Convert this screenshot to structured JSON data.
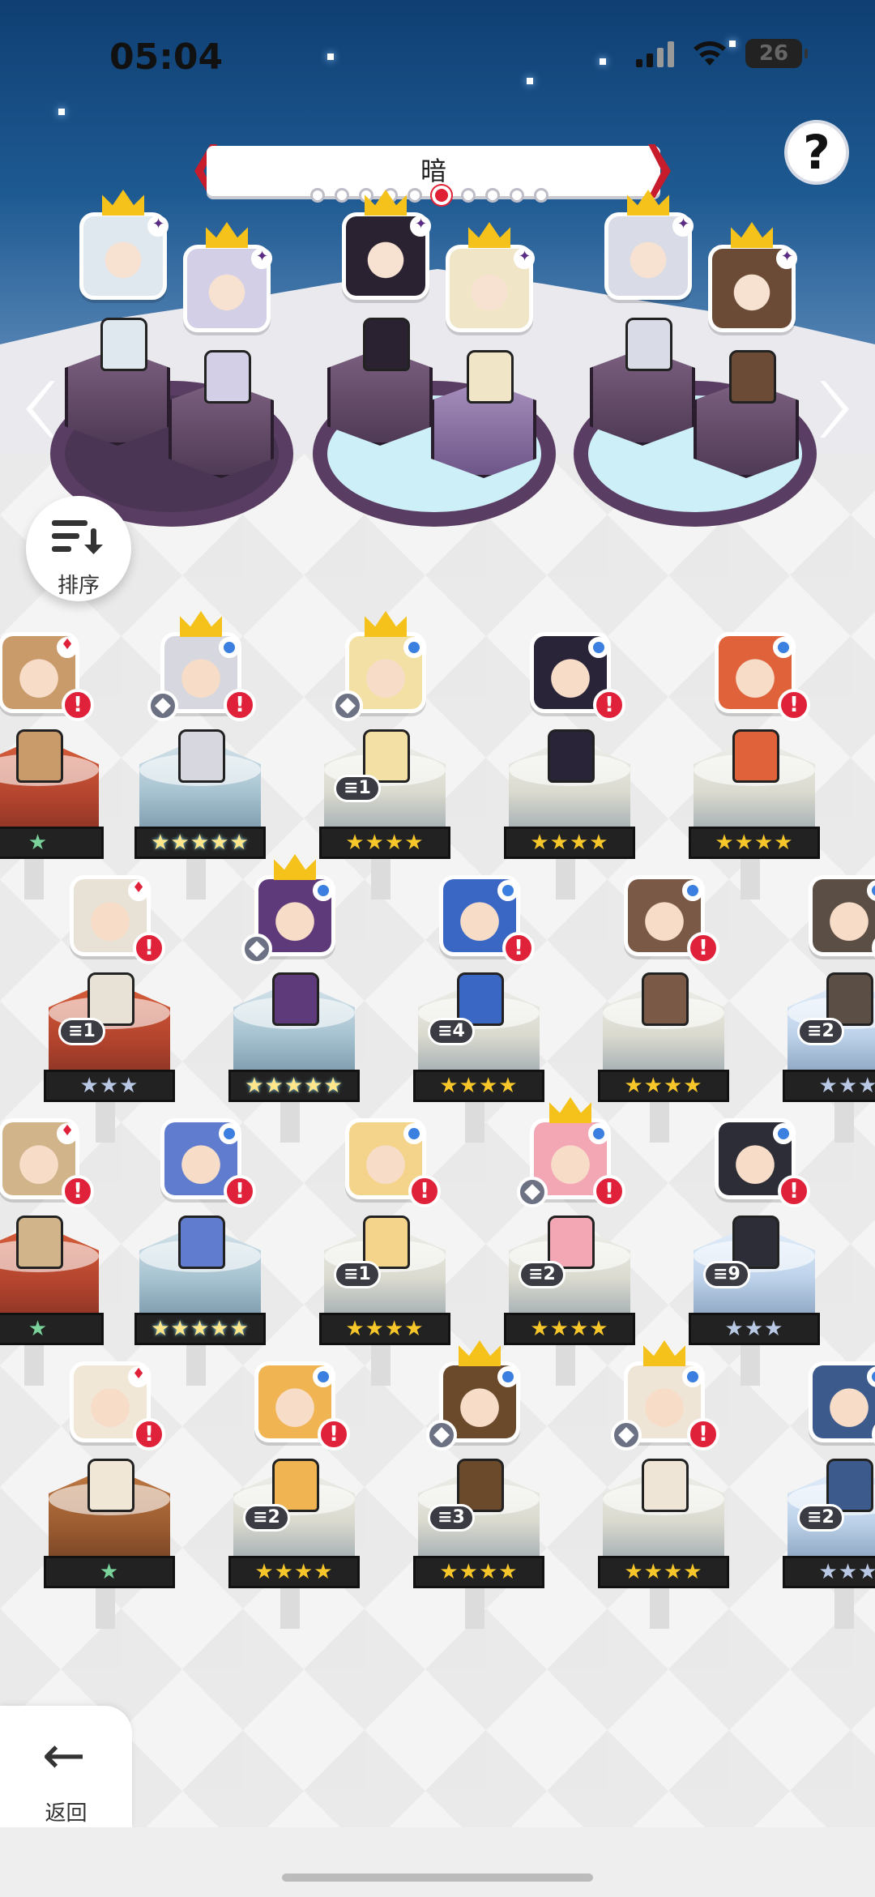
{
  "status_bar": {
    "time": "05:04",
    "battery": "26"
  },
  "banner": {
    "title": "暗",
    "page_count": 10,
    "active_page": 6
  },
  "help": {
    "label": "?"
  },
  "sort": {
    "label": "排序"
  },
  "back": {
    "label": "返回"
  },
  "team": [
    {
      "leader": true,
      "element": "dark",
      "face": "#dfe7ef"
    },
    {
      "leader": true,
      "element": "dark",
      "face": "#d3cfe6"
    },
    {
      "leader": true,
      "element": "dark",
      "face": "#2a2230"
    },
    {
      "leader": true,
      "element": "dark",
      "face": "#f1e5c8"
    },
    {
      "leader": true,
      "element": "dark",
      "face": "#d9dbe6"
    },
    {
      "leader": true,
      "element": "dark",
      "face": "#6b4b36"
    }
  ],
  "roster": [
    {
      "element": "fire",
      "stars": "★",
      "face": "#c99b6b",
      "alert": "!"
    },
    {
      "element": "water",
      "stars": "★★★★★",
      "face": "#d7d7df",
      "crown": true,
      "awaken": true,
      "alert": "!"
    },
    {
      "element": "water",
      "stars": "★★★★",
      "face": "#f3e0a4",
      "crown": true,
      "awaken": true,
      "dup": "1"
    },
    {
      "element": "water",
      "stars": "★★★★",
      "face": "#2a2438",
      "alert": "!"
    },
    {
      "element": "water",
      "stars": "★★★★",
      "face": "#e0623a",
      "alert": "!"
    },
    {
      "element": "fire",
      "stars": "★★★",
      "face": "#e8e2d6",
      "alert": "!",
      "dup": "1"
    },
    {
      "element": "water",
      "stars": "★★★★★",
      "face": "#5f3a7a",
      "crown": true,
      "awaken": true
    },
    {
      "element": "water",
      "stars": "★★★★",
      "face": "#3b67c4",
      "alert": "!",
      "dup": "4"
    },
    {
      "element": "water",
      "stars": "★★★★",
      "face": "#7a5a46",
      "alert": "!"
    },
    {
      "element": "water",
      "stars": "★★★",
      "face": "#5a4e45",
      "alert": "!",
      "dup": "2"
    },
    {
      "element": "fire",
      "stars": "★",
      "face": "#d1b48a",
      "alert": "!"
    },
    {
      "element": "water",
      "stars": "★★★★★",
      "face": "#5f7ccf",
      "alert": "!"
    },
    {
      "element": "water",
      "stars": "★★★★",
      "face": "#f4d48a",
      "alert": "!",
      "dup": "1"
    },
    {
      "element": "water",
      "stars": "★★★★",
      "face": "#f3a7b5",
      "crown": true,
      "awaken": true,
      "alert": "!",
      "dup": "2"
    },
    {
      "element": "water",
      "stars": "★★★",
      "face": "#2d2d38",
      "alert": "!",
      "dup": "9"
    },
    {
      "element": "fire",
      "stars": "★",
      "face": "#f1e7d7",
      "alert": "!"
    },
    {
      "element": "water",
      "stars": "★★★★",
      "face": "#f0b552",
      "alert": "!",
      "dup": "2"
    },
    {
      "element": "water",
      "stars": "★★★★",
      "face": "#6b4a2c",
      "crown": true,
      "awaken": true,
      "dup": "3"
    },
    {
      "element": "water",
      "stars": "★★★★",
      "face": "#efe5d6",
      "crown": true,
      "awaken": true,
      "alert": "!"
    },
    {
      "element": "water",
      "stars": "★★★",
      "face": "#3c5b8c",
      "alert": "!",
      "dup": "2"
    }
  ],
  "colors": {
    "accent_red": "#e0213a",
    "star_gold": "#f6c62a",
    "team_platform": "#5a3d63"
  }
}
